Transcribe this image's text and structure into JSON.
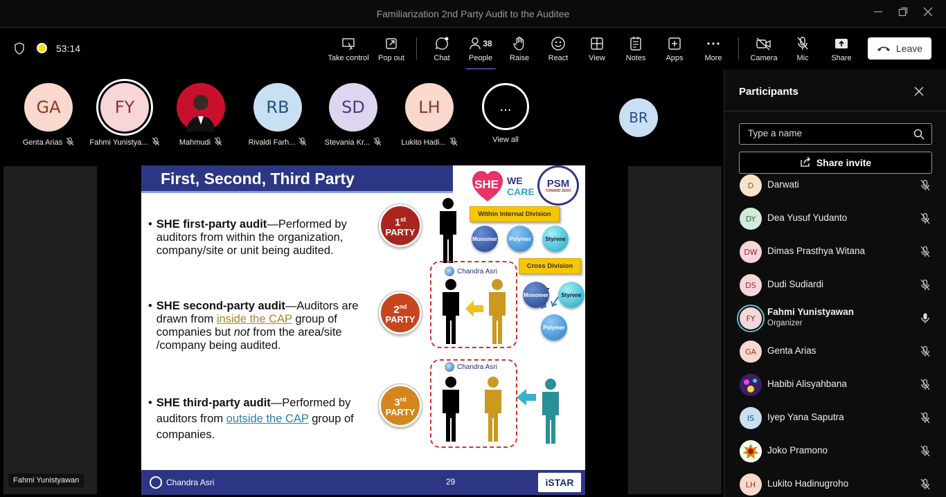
{
  "window": {
    "title": "Familiarization 2nd Party Audit to the Auditee"
  },
  "toolbar": {
    "timer": "53:14",
    "buttons": {
      "take_control": "Take control",
      "pop_out": "Pop out",
      "chat": "Chat",
      "people": "People",
      "people_count": "38",
      "raise": "Raise",
      "react": "React",
      "view": "View",
      "notes": "Notes",
      "apps": "Apps",
      "more": "More",
      "camera": "Camera",
      "mic": "Mic",
      "share": "Share",
      "leave": "Leave"
    }
  },
  "stage": {
    "strip": [
      {
        "initials": "GA",
        "name": "Genta Arias",
        "bg": "#f9d8cd",
        "fg": "#8a3b1e"
      },
      {
        "initials": "FY",
        "name": "Fahmi Yunistya...",
        "bg": "#f6d6d9",
        "fg": "#8a2c3a"
      },
      {
        "initials": "",
        "name": "Mahmudi",
        "bg": "#c8102e",
        "fg": "#fff"
      },
      {
        "initials": "RB",
        "name": "Rivaldi Farh...",
        "bg": "#c9dff2",
        "fg": "#22517d"
      },
      {
        "initials": "SD",
        "name": "Stevania Kr...",
        "bg": "#ddd6ee",
        "fg": "#4b3b7c"
      },
      {
        "initials": "LH",
        "name": "Lukito Hadi...",
        "bg": "#f9d8cd",
        "fg": "#8a3b1e"
      }
    ],
    "view_all": {
      "glyph": "...",
      "label": "View all"
    },
    "floating_avatar": "BR",
    "caption_name": "Fahmi Yunistyawan"
  },
  "slide": {
    "title": "First, Second, Third Party",
    "bullets": [
      {
        "bold": "SHE first-party audit",
        "rest": "—Performed by auditors from within the organization, company/site or unit being audited."
      },
      {
        "bold": "SHE second-party audit",
        "pre": "—Auditors are drawn from ",
        "link": "inside the CAP",
        "post_pre": " group of companies but ",
        "italic": "not",
        "post": " from the area/site  /company being audited."
      },
      {
        "bold": "SHE third-party audit",
        "pre": "—Performed by auditors from ",
        "link": "outside the CAP",
        "post": " group of companies."
      }
    ],
    "badges": [
      {
        "num": "1",
        "sup": "st",
        "word": "PARTY",
        "color": "#a8261f"
      },
      {
        "num": "2",
        "sup": "nd",
        "word": "PARTY",
        "color": "#c8451e"
      },
      {
        "num": "3",
        "sup": "rd",
        "word": "PARTY",
        "color": "#d4861e"
      }
    ],
    "labels": {
      "internal": "Within Internal Division",
      "cross": "Cross Division"
    },
    "balls": {
      "monomer": "Monomer",
      "polymer": "Polymer",
      "styrene": "Styrene"
    },
    "chandra_asri": "Chandra Asri",
    "logos": {
      "she": "SHE",
      "we": "WE",
      "care": "CARE",
      "psm": "PSM",
      "psm_sub": "TOWARD ZERO"
    },
    "footer": {
      "brand": "Chandra Asri",
      "page": "29",
      "istar": "iSTAR"
    },
    "colors": {
      "navy": "#2d3685",
      "red_dash": "#d92b2b",
      "gold": "#c99a1e",
      "teal": "#2a8f96"
    }
  },
  "participants": {
    "title": "Participants",
    "search_placeholder": "Type a name",
    "share_invite": "Share invite",
    "list": [
      {
        "initials": "D",
        "name": "Darwati",
        "bg": "#f7e3c9",
        "fg": "#8a5a1e"
      },
      {
        "initials": "DY",
        "name": "Dea Yusuf Yudanto",
        "bg": "#d6ead9",
        "fg": "#2f6b3a"
      },
      {
        "initials": "DW",
        "name": "Dimas Prasthya Witana",
        "bg": "#f6d6d9",
        "fg": "#8a2c3a"
      },
      {
        "initials": "DS",
        "name": "Dudi Sudiardi",
        "bg": "#f6d6d9",
        "fg": "#8a2c3a"
      },
      {
        "initials": "FY",
        "name": "Fahmi Yunistyawan",
        "role": "Organizer",
        "bg": "#f6d6d9",
        "fg": "#8a2c3a",
        "organizer": true
      },
      {
        "initials": "GA",
        "name": "Genta Arias",
        "bg": "#f9d8cd",
        "fg": "#8a3b1e"
      },
      {
        "initials": "",
        "name": "Habibi Alisyahbana",
        "bg": "#4a2a6a",
        "fg": "#fff"
      },
      {
        "initials": "IS",
        "name": "Iyep Yana Saputra",
        "bg": "#c9dff2",
        "fg": "#22517d"
      },
      {
        "initials": "",
        "name": "Joko Pramono",
        "bg": "#fff",
        "fg": "#c00"
      },
      {
        "initials": "LH",
        "name": "Lukito Hadinugroho",
        "bg": "#f9d8cd",
        "fg": "#8a3b1e"
      }
    ]
  }
}
